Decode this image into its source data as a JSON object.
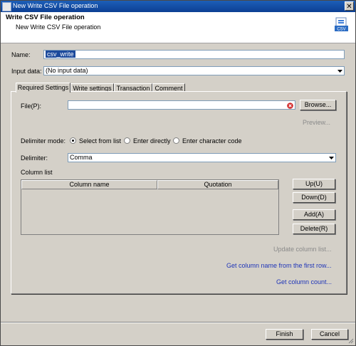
{
  "window": {
    "title": "New Write CSV File operation",
    "close_glyph": "✕"
  },
  "header": {
    "title": "Write CSV File operation",
    "subtitle": "New Write CSV File operation",
    "icon": "csv-file-icon"
  },
  "form": {
    "name_label": "Name:",
    "name_value": "csv_write",
    "input_label": "Input data:",
    "input_value": "(No input data)"
  },
  "tabs": [
    {
      "label": "Required Settings",
      "active": true
    },
    {
      "label": "Write settings",
      "active": false
    },
    {
      "label": "Transaction",
      "active": false
    },
    {
      "label": "Comment",
      "active": false
    }
  ],
  "required": {
    "file_label": "File(P):",
    "file_value": "",
    "browse_button": "Browse...",
    "preview_button": "Preview...",
    "delimiter_mode_label": "Delimiter mode:",
    "radio_options": [
      {
        "label": "Select from list",
        "selected": true
      },
      {
        "label": "Enter directly",
        "selected": false
      },
      {
        "label": "Enter character code",
        "selected": false
      }
    ],
    "delimiter_label": "Delimiter:",
    "delimiter_value": "Comma",
    "column_list_label": "Column list",
    "columns": [
      "Column name",
      "Quotation"
    ],
    "up_button": "Up(U)",
    "down_button": "Down(D)",
    "add_button": "Add(A)",
    "delete_button": "Delete(R)",
    "update_column_list": "Update column list...",
    "get_column_name": "Get column name from the first row...",
    "get_column_count": "Get column count..."
  },
  "footer": {
    "finish_button": "Finish",
    "cancel_button": "Cancel"
  },
  "colors": {
    "titlebar": "#0c3f93",
    "link": "#1f35b8",
    "selection": "#1c4a9c",
    "error_icon": "#d22a2a"
  }
}
